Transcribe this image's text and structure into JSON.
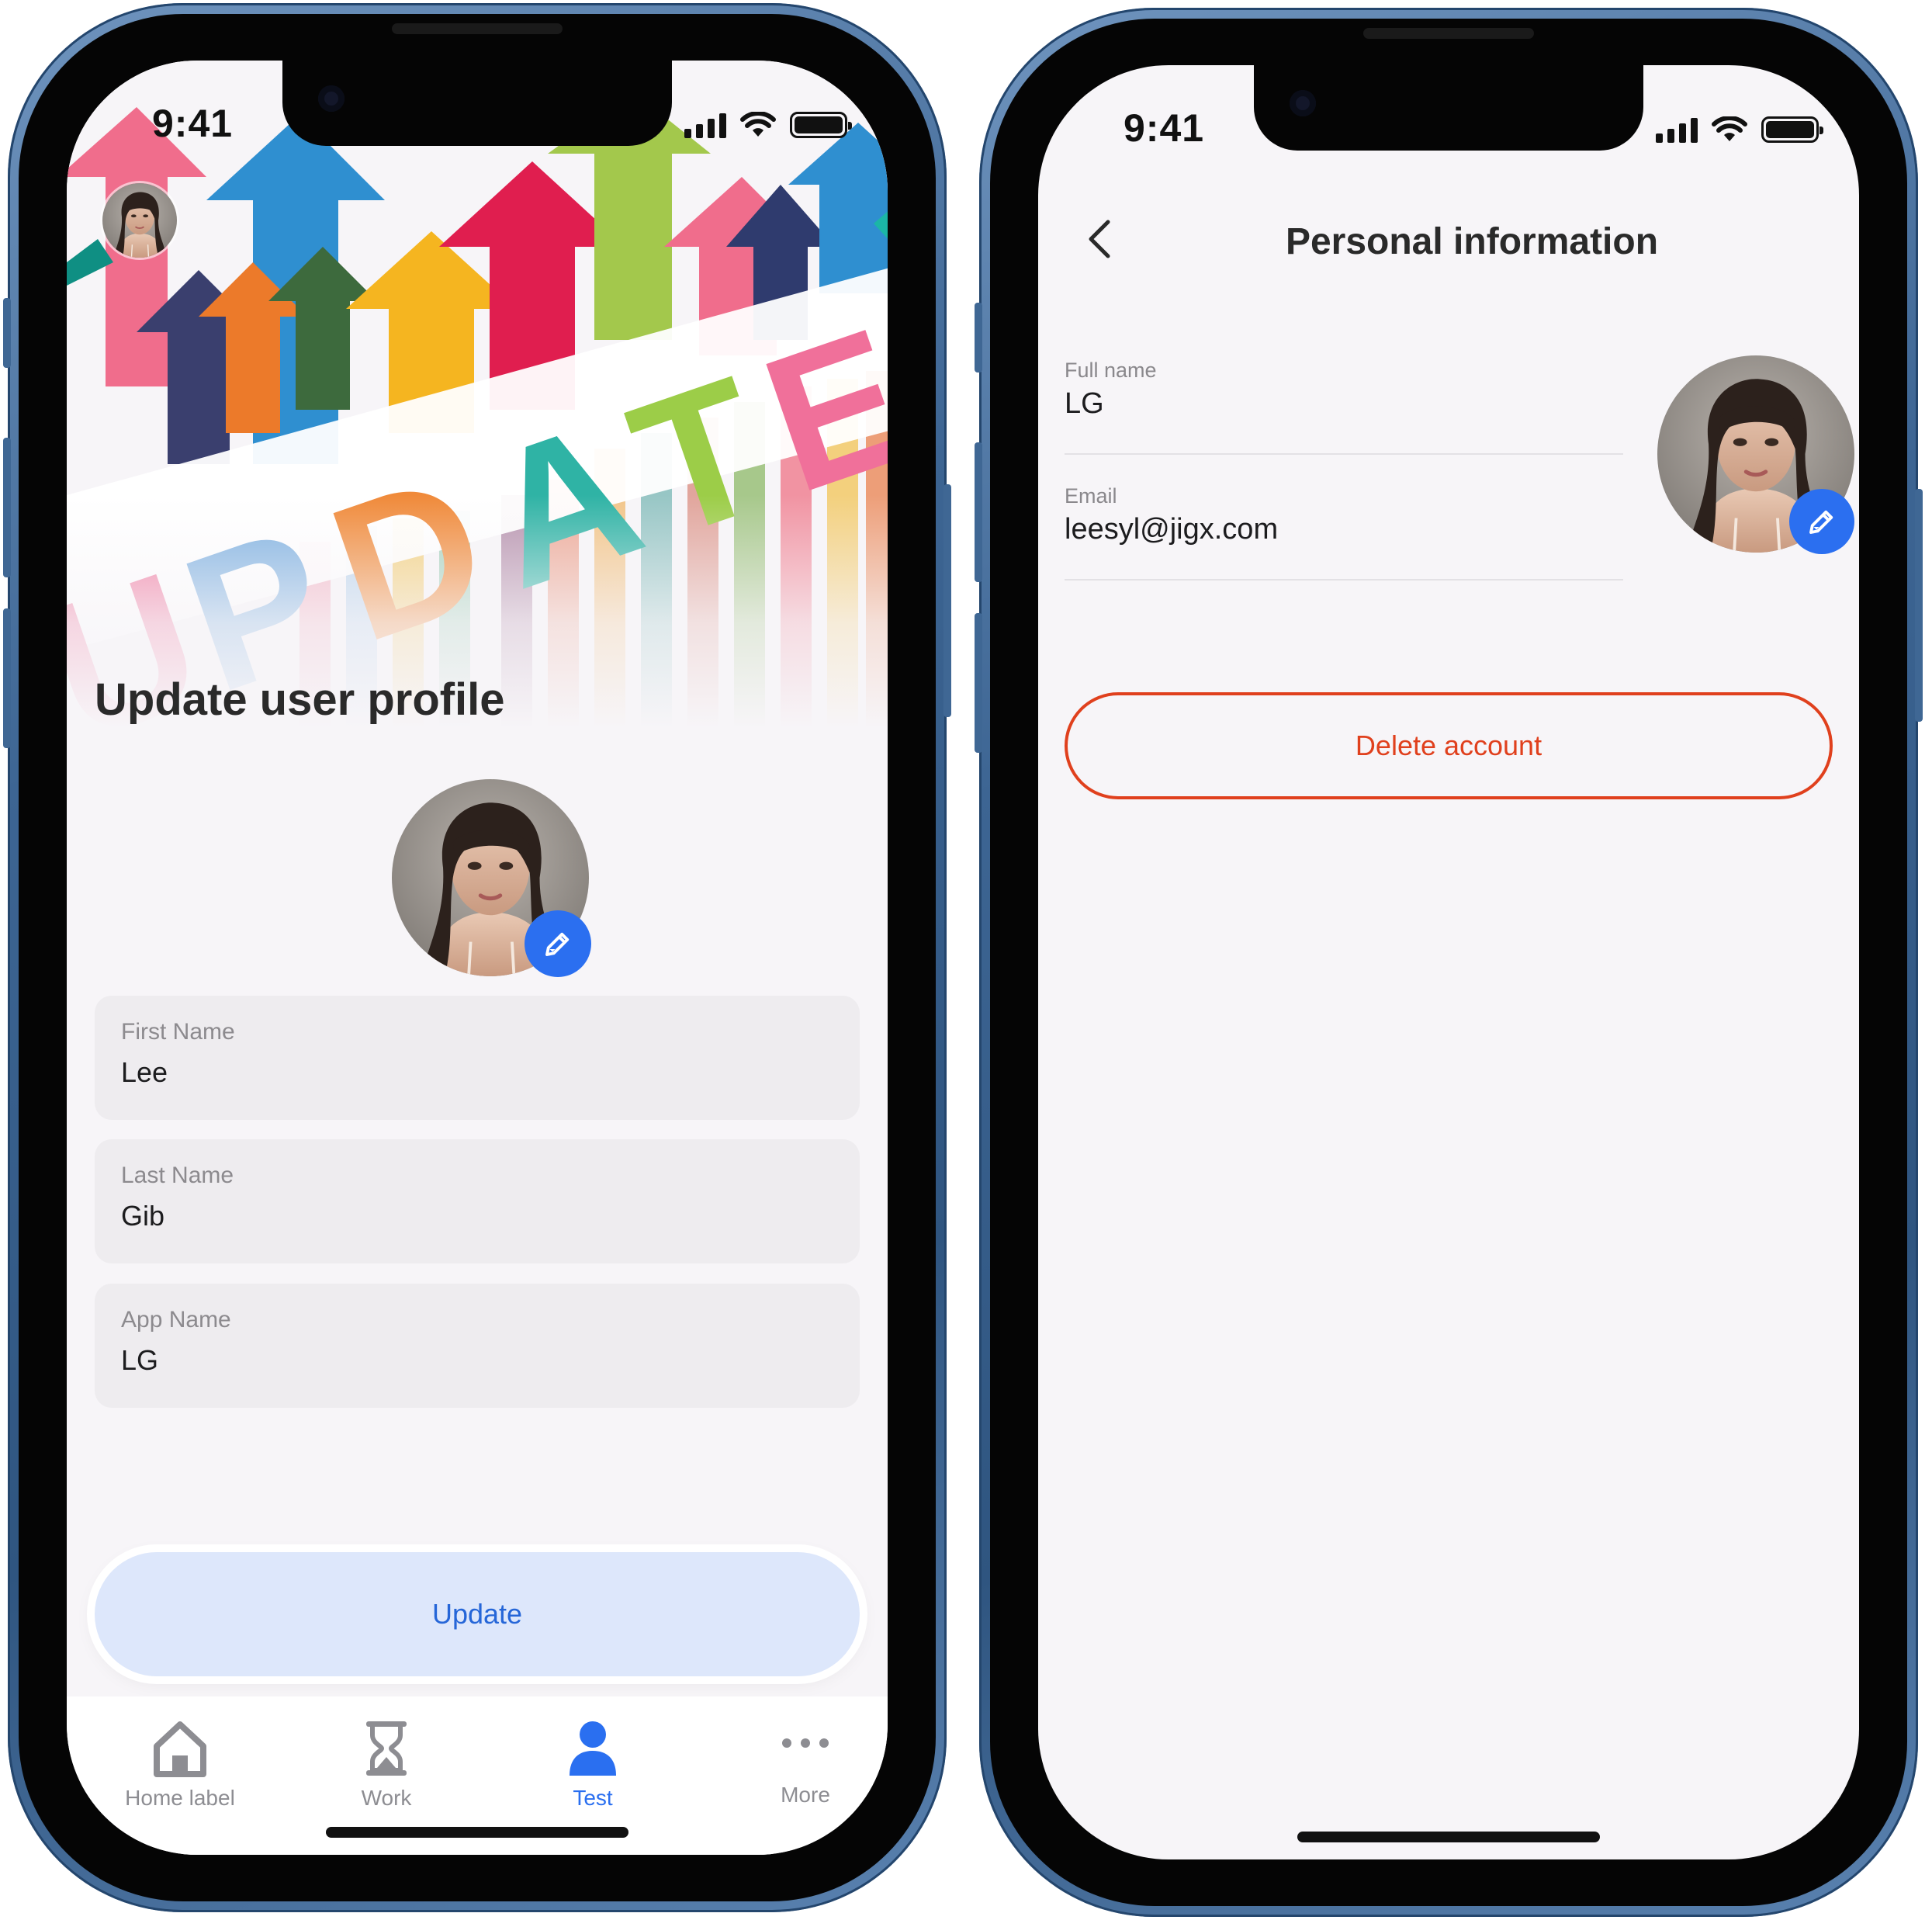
{
  "status": {
    "time": "9:41"
  },
  "profile_screen": {
    "title": "Update user profile",
    "fields": [
      {
        "label": "First Name",
        "value": "Lee"
      },
      {
        "label": "Last Name",
        "value": "Gib"
      },
      {
        "label": "App Name",
        "value": "LG"
      }
    ],
    "update_label": "Update",
    "tabs": [
      {
        "label": "Home label",
        "icon": "home-icon",
        "active": false
      },
      {
        "label": "Work",
        "icon": "hourglass-icon",
        "active": false
      },
      {
        "label": "Test",
        "icon": "person-icon",
        "active": true
      },
      {
        "label": "More",
        "icon": "more-dots-icon",
        "active": false
      }
    ]
  },
  "personal_screen": {
    "title": "Personal information",
    "full_name_label": "Full name",
    "full_name": "LG",
    "email_label": "Email",
    "email": "leesyl@jigx.com",
    "delete_label": "Delete account"
  },
  "colors": {
    "accent": "#2b6ff0",
    "danger": "#e0401d",
    "update_button_bg": "#dde7fb",
    "frame": "#3d6593"
  }
}
